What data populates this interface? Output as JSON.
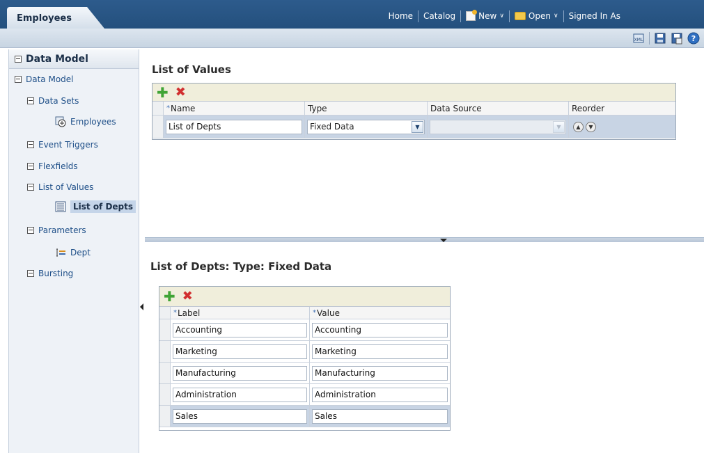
{
  "app": {
    "active_tab": "Employees",
    "nav": {
      "home": "Home",
      "catalog": "Catalog",
      "new": "New",
      "open": "Open",
      "signed_in": "Signed In As"
    }
  },
  "sidebar": {
    "header": "Data Model",
    "items": {
      "data_model": "Data Model",
      "data_sets": "Data Sets",
      "employees": "Employees",
      "event_triggers": "Event Triggers",
      "flexfields": "Flexfields",
      "list_of_values": "List of Values",
      "list_of_depts": "List of Depts",
      "parameters": "Parameters",
      "dept": "Dept",
      "bursting": "Bursting"
    }
  },
  "lov": {
    "title": "List of Values",
    "columns": {
      "name": "Name",
      "type": "Type",
      "data_source": "Data Source",
      "reorder": "Reorder"
    },
    "row": {
      "name": "List of Depts",
      "type": "Fixed Data",
      "data_source": ""
    }
  },
  "detail": {
    "title": "List of Depts: Type: Fixed Data",
    "columns": {
      "label": "Label",
      "value": "Value"
    },
    "rows": [
      {
        "label": "Accounting",
        "value": "Accounting"
      },
      {
        "label": "Marketing",
        "value": "Marketing"
      },
      {
        "label": "Manufacturing",
        "value": "Manufacturing"
      },
      {
        "label": "Administration",
        "value": "Administration"
      },
      {
        "label": "Sales",
        "value": "Sales"
      }
    ],
    "selected_row": 4
  },
  "colors": {
    "topbar": "#24507d",
    "selection": "#c8d4e4",
    "link": "#1e4f88"
  }
}
